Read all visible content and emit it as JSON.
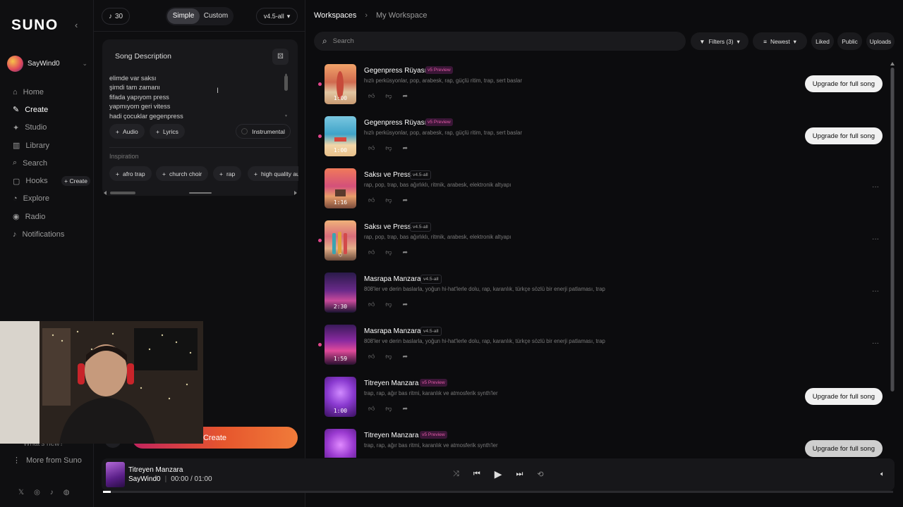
{
  "sidebar": {
    "logo": "SUNO",
    "user": "SayWind0",
    "nav": [
      {
        "label": "Home",
        "icon": "home-icon"
      },
      {
        "label": "Create",
        "icon": "create-icon"
      },
      {
        "label": "Studio",
        "icon": "studio-icon"
      },
      {
        "label": "Library",
        "icon": "library-icon"
      },
      {
        "label": "Search",
        "icon": "search-icon"
      },
      {
        "label": "Hooks",
        "icon": "hooks-icon"
      },
      {
        "label": "Explore",
        "icon": "explore-icon"
      },
      {
        "label": "Radio",
        "icon": "radio-icon"
      },
      {
        "label": "Notifications",
        "icon": "bell-icon"
      }
    ],
    "hooks_badge": "+ Create",
    "whats_new": "What's new?",
    "more_from": "More from Suno"
  },
  "create_panel": {
    "credits": "30",
    "mode_simple": "Simple",
    "mode_custom": "Custom",
    "version": "v4.5-all",
    "card_title": "Song Description",
    "lyrics_lines": [
      "elimde var saksı",
      "şimdi tam zamanı",
      "fifada yapıyom press",
      "yapmıyom geri vitess",
      "hadi çocuklar gegenpress"
    ],
    "audio_label": "Audio",
    "lyrics_label": "Lyrics",
    "instrumental_label": "Instrumental",
    "inspiration_label": "Inspiration",
    "inspiration_tags": [
      "afro trap",
      "church choir",
      "rap",
      "high quality au"
    ],
    "create_button": "Create"
  },
  "main": {
    "breadcrumb_root": "Workspaces",
    "breadcrumb_current": "My Workspace",
    "search_placeholder": "Search",
    "filters": "Filters (3)",
    "sort": "Newest",
    "liked": "Liked",
    "public": "Public",
    "uploads": "Uploads",
    "songs": [
      {
        "title": "Gegenpress Rüyası",
        "tag": "v5 Preview",
        "desc": "hızlı perküsyonlar, pop, arabesk, rap, güçlü ritim, trap, sert baslar",
        "duration": "1:00",
        "action": "Upgrade for full song"
      },
      {
        "title": "Gegenpress Rüyası",
        "tag": "v5 Preview",
        "desc": "hızlı perküsyonlar, pop, arabesk, rap, güçlü ritim, trap, sert baslar",
        "duration": "1:00",
        "action": "Upgrade for full song"
      },
      {
        "title": "Saksı ve Press",
        "tag": "v4.5-all",
        "desc": "rap, pop, trap, bas ağırlıklı, ritmik, arabesk, elektronik altyapı",
        "duration": "1:16",
        "action": ""
      },
      {
        "title": "Saksı ve Press",
        "tag": "v4.5-all",
        "desc": "rap, pop, trap, bas ağırlıklı, ritmik, arabesk, elektronik altyapı",
        "duration": "",
        "action": ""
      },
      {
        "title": "Masrapa Manzara",
        "tag": "v4.5-all",
        "desc": "808'ler ve derin baslarla, yoğun hi-hat'lerle dolu, rap, karanlık, türkçe sözlü bir enerji patlaması, trap",
        "duration": "2:30",
        "action": ""
      },
      {
        "title": "Masrapa Manzara",
        "tag": "v4.5-all",
        "desc": "808'ler ve derin baslarla, yoğun hi-hat'lerle dolu, rap, karanlık, türkçe sözlü bir enerji patlaması, trap",
        "duration": "1:59",
        "action": ""
      },
      {
        "title": "Titreyen Manzara",
        "tag": "v5 Preview",
        "desc": "trap, rap, ağır bas ritmi, karanlık ve atmosferik synth'ler",
        "duration": "1:00",
        "action": "Upgrade for full song"
      },
      {
        "title": "Titreyen Manzara",
        "tag": "v5 Preview",
        "desc": "trap, rap, ağır bas ritmi, karanlık ve atmosferik synth'ler",
        "duration": "",
        "action": "Upgrade for full song"
      }
    ]
  },
  "player": {
    "title": "Titreyen Manzara",
    "artist": "SayWind0",
    "time": "00:00 /  01:00",
    "progress": 0.01
  },
  "colors": {
    "accent": "#e0458a",
    "create_gradient_start": "#c2235e",
    "create_gradient_end": "#f07b3a"
  }
}
